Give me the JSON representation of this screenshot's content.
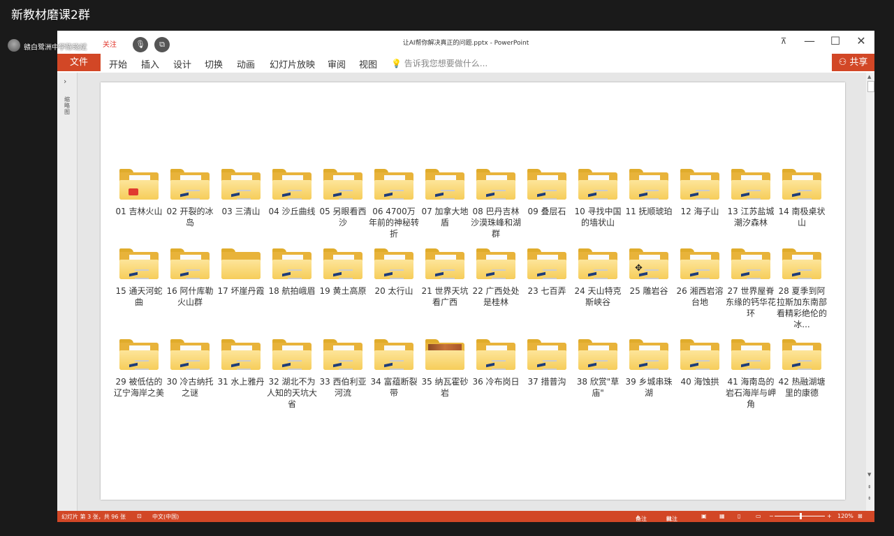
{
  "stream": {
    "title": "新教材磨课2群"
  },
  "overlay": {
    "user_name": "赣白鹭洲中学陈晓斌",
    "follow_label": "关注"
  },
  "window": {
    "title": "让AI帮你解决真正的问题.pptx - PowerPoint",
    "restore_icon": "restore-icon",
    "minimize": "—",
    "maximize": "☐",
    "close": "✕"
  },
  "ribbon": {
    "file": "文件",
    "tabs": [
      "开始",
      "插入",
      "设计",
      "切换",
      "动画",
      "幻灯片放映",
      "审阅",
      "视图"
    ],
    "tell_me": "告诉我您想要做什么...",
    "share": "共享"
  },
  "thumbnail_pane": {
    "expand": "›",
    "label": "缩略图"
  },
  "folders": [
    {
      "label": "01 吉林火山",
      "icon": "pdf"
    },
    {
      "label": "02 开裂的冰岛",
      "icon": "doc"
    },
    {
      "label": "03 三清山",
      "icon": "doc"
    },
    {
      "label": "04 沙丘曲线",
      "icon": "doc"
    },
    {
      "label": "05 另眼看西沙",
      "icon": "doc"
    },
    {
      "label": "06 4700万年前的神秘转折",
      "icon": "doc"
    },
    {
      "label": "07 加拿大地盾",
      "icon": "doc"
    },
    {
      "label": "08 巴丹吉林沙漠珠峰和湖群",
      "icon": "doc"
    },
    {
      "label": "09 叠层石",
      "icon": "doc"
    },
    {
      "label": "10 寻找中国的墙状山",
      "icon": "doc"
    },
    {
      "label": "11 抚顺琥珀",
      "icon": "doc"
    },
    {
      "label": "12 海子山",
      "icon": "doc"
    },
    {
      "label": "13 江苏盐城潮汐森林",
      "icon": "doc"
    },
    {
      "label": "14 南极桌状山",
      "icon": "doc"
    },
    {
      "label": "15 通天河蛇曲",
      "icon": "doc"
    },
    {
      "label": "16 阿什库勒火山群",
      "icon": "doc"
    },
    {
      "label": "17 坏崖丹霞",
      "icon": "empty"
    },
    {
      "label": "18 航拍峨眉",
      "icon": "doc"
    },
    {
      "label": "19 黄土高原",
      "icon": "doc"
    },
    {
      "label": "20 太行山",
      "icon": "doc"
    },
    {
      "label": "21 世界天坑看广西",
      "icon": "doc"
    },
    {
      "label": "22 广西处处是桂林",
      "icon": "doc"
    },
    {
      "label": "23 七百弄",
      "icon": "doc"
    },
    {
      "label": "24 天山特克斯峡谷",
      "icon": "doc"
    },
    {
      "label": "25 雕岩谷",
      "icon": "doc"
    },
    {
      "label": "26 湘西岩溶台地",
      "icon": "doc"
    },
    {
      "label": "27 世界屋脊东缘的钙华花环",
      "icon": "doc"
    },
    {
      "label": "28 夏季到阿拉斯加东南部看精彩绝伦的冰...",
      "icon": "doc"
    },
    {
      "label": "29 被低估的 辽宁海岸之美",
      "icon": "doc"
    },
    {
      "label": "30 冷古纳托之谜",
      "icon": "doc"
    },
    {
      "label": "31 水上雅丹",
      "icon": "doc"
    },
    {
      "label": "32 湖北不为人知的天坑大省",
      "icon": "doc"
    },
    {
      "label": "33 西伯利亚河流",
      "icon": "doc"
    },
    {
      "label": "34 富蕴断裂带",
      "icon": "doc"
    },
    {
      "label": "35 纳瓦霍砂岩",
      "icon": "photo"
    },
    {
      "label": "36 冷布岗日",
      "icon": "doc"
    },
    {
      "label": "37 措普沟",
      "icon": "doc"
    },
    {
      "label": "38 欣赏\"草庙\"",
      "icon": "doc"
    },
    {
      "label": "39 乡城串珠湖",
      "icon": "doc"
    },
    {
      "label": "40 海蚀拱",
      "icon": "doc"
    },
    {
      "label": "41 海南岛的岩石海岸与岬角",
      "icon": "doc"
    },
    {
      "label": "42 热融湖塘里的康德",
      "icon": "doc"
    }
  ],
  "status": {
    "slide_info": "幻灯片 第 3 张，共 96 张",
    "language": "中文(中国)",
    "notes": "备注",
    "comments": "批注",
    "zoom": "120%"
  },
  "colors": {
    "accent": "#d24726",
    "folder_front": "#f6cd5a",
    "folder_back": "#e0ac2c"
  }
}
